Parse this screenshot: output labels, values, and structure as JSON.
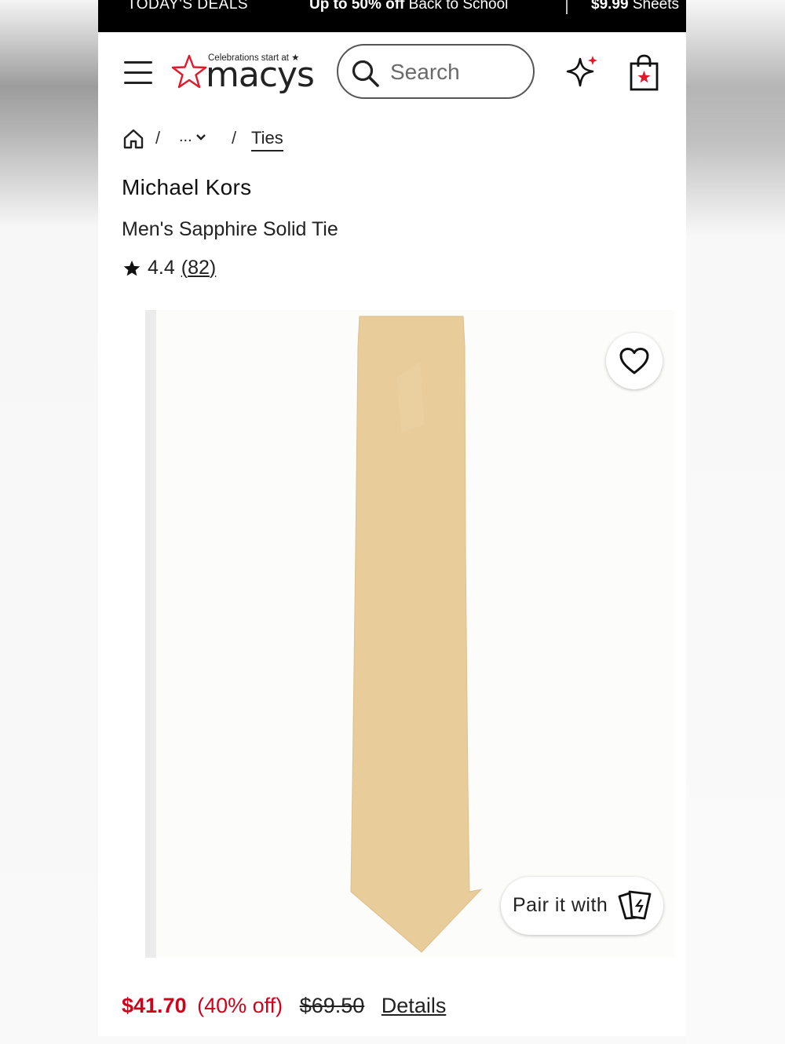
{
  "promo_bar": {
    "item1": "TODAY'S DEALS",
    "item2_bold": "Up to 50% off",
    "item2_rest": " Back to School",
    "item3_bold": "$9.99",
    "item3_rest": " Sheets"
  },
  "header": {
    "logo_tagline": "Celebrations start at ★",
    "logo_text": "macys",
    "search_placeholder": "Search"
  },
  "breadcrumb": {
    "separator": "/",
    "ellipsis": "...",
    "current": "Ties"
  },
  "product": {
    "brand": "Michael Kors",
    "name": "Men's Sapphire Solid Tie",
    "rating": "4.4",
    "review_count_open": "(",
    "review_count": "82",
    "review_count_close": ")",
    "pair_label": "Pair it with",
    "price_sale": "$41.70",
    "price_discount": "(40% off)",
    "price_original": "$69.50",
    "details_link": "Details"
  },
  "colors": {
    "accent": "#d0021b",
    "tie": "#e8cc9a"
  }
}
